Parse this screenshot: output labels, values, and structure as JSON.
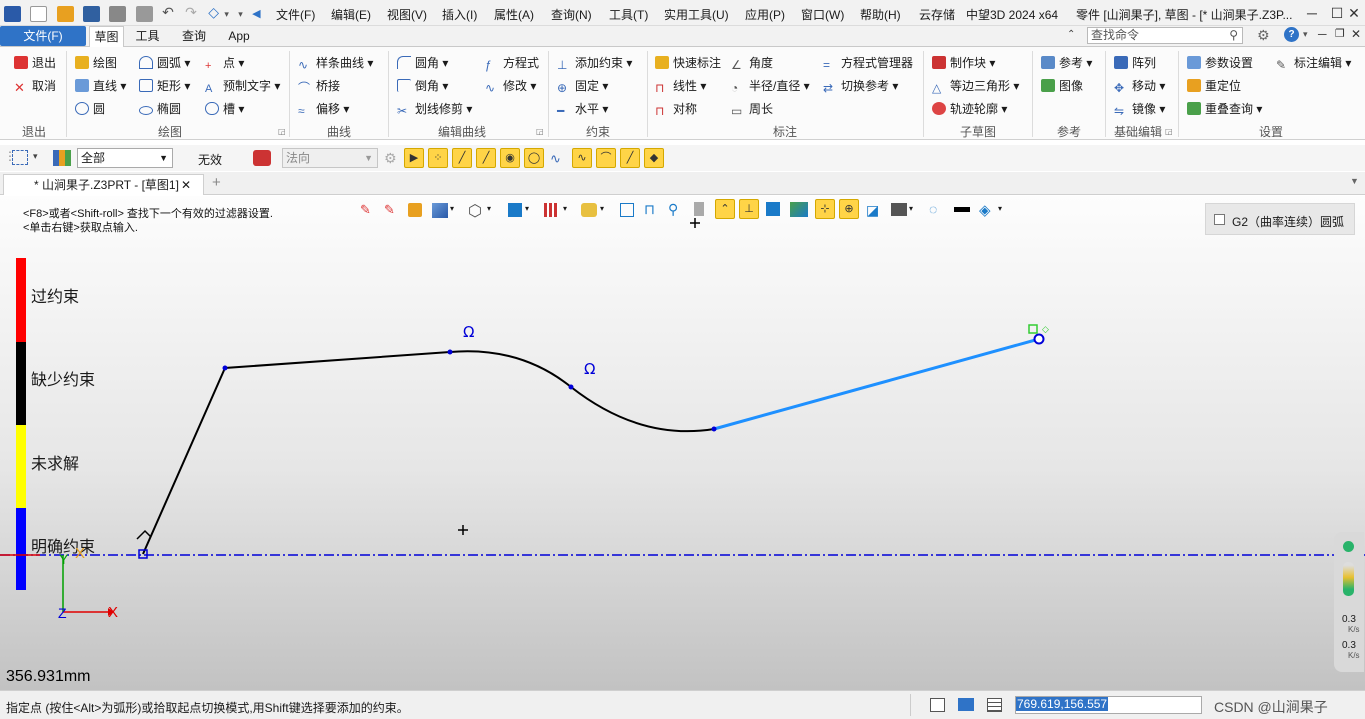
{
  "titlebar": {
    "menus": [
      "文件(F)",
      "编辑(E)",
      "视图(V)",
      "插入(I)",
      "属性(A)",
      "查询(N)",
      "工具(T)",
      "实用工具(U)",
      "应用(P)",
      "窗口(W)",
      "帮助(H)",
      "云存储"
    ],
    "app_name": "中望3D 2024 x64",
    "doc_title": "零件 [山涧果子], 草图 - [* 山涧果子.Z3P..."
  },
  "tabs": {
    "file": "文件(F)",
    "items": [
      "草图",
      "工具",
      "查询",
      "App"
    ]
  },
  "search": {
    "placeholder": "查找命令"
  },
  "ribbon": {
    "exit_group": {
      "exit": "退出",
      "cancel": "取消",
      "label": "退出"
    },
    "draw_group": {
      "draw": "绘图",
      "line": "直线",
      "circle": "圆",
      "arc": "圆弧",
      "rect": "矩形",
      "ellipse": "椭圆",
      "point": "点",
      "pretext": "预制文字",
      "slot": "槽",
      "label": "绘图"
    },
    "curve_group": {
      "spline": "样条曲线",
      "bridge": "桥接",
      "offset": "偏移",
      "label": "曲线"
    },
    "edit_group": {
      "fillet": "圆角",
      "chamfer": "倒角",
      "trim": "划线修剪",
      "equation": "方程式",
      "modify": "修改",
      "label": "编辑曲线"
    },
    "constraint_group": {
      "add": "添加约束",
      "fix": "固定",
      "horizontal": "水平",
      "label": "约束"
    },
    "dim_group": {
      "quick": "快速标注",
      "linear": "线性",
      "symmetric": "对称",
      "angle": "角度",
      "radius": "半径/直径",
      "perimeter": "周长",
      "eqmgr": "方程式管理器",
      "switchref": "切换参考",
      "label": "标注"
    },
    "subsketch_group": {
      "makeblock": "制作块",
      "triangle": "等边三角形",
      "trajectory": "轨迹轮廓",
      "label": "子草图"
    },
    "ref_group": {
      "ref": "参考",
      "image": "图像",
      "label": "参考"
    },
    "basic_group": {
      "array": "阵列",
      "move": "移动",
      "mirror": "镜像",
      "label": "基础编辑"
    },
    "settings_group": {
      "params": "参数设置",
      "reposition": "重定位",
      "overlap": "重叠查询",
      "dimedit": "标注编辑",
      "label": "设置"
    }
  },
  "toolbar2": {
    "filter": "全部",
    "invalid": "无效",
    "direction": "法向"
  },
  "doctab": {
    "label": "* 山涧果子.Z3PRT - [草图1]"
  },
  "canvas": {
    "hint1": "<F8>或者<Shift-roll> 查找下一个有效的过滤器设置.",
    "hint2": "<单击右键>获取点输入.",
    "legend": [
      "过约束",
      "缺少约束",
      "未求解",
      "明确约束"
    ],
    "g2_label": "G2（曲率连续）圆弧",
    "measure": "356.931mm",
    "speed1": "0.3",
    "speed1_unit": "K/s",
    "speed2": "0.3",
    "speed2_unit": "K/s"
  },
  "axes": {
    "x": "X",
    "y": "Y",
    "z": "Z"
  },
  "status": {
    "prompt": "指定点 (按住<Alt>为弧形)或拾取起点切换模式,用Shift键选择要添加的约束。",
    "coords": "769.619,156.557",
    "watermark": "CSDN @山涧果子"
  },
  "colors": {
    "accent": "#2f73c7",
    "over": "#ff0000",
    "under": "#000000",
    "unsolved": "#ffff00",
    "fully": "#0000ff",
    "sel_line": "#1e90ff"
  }
}
